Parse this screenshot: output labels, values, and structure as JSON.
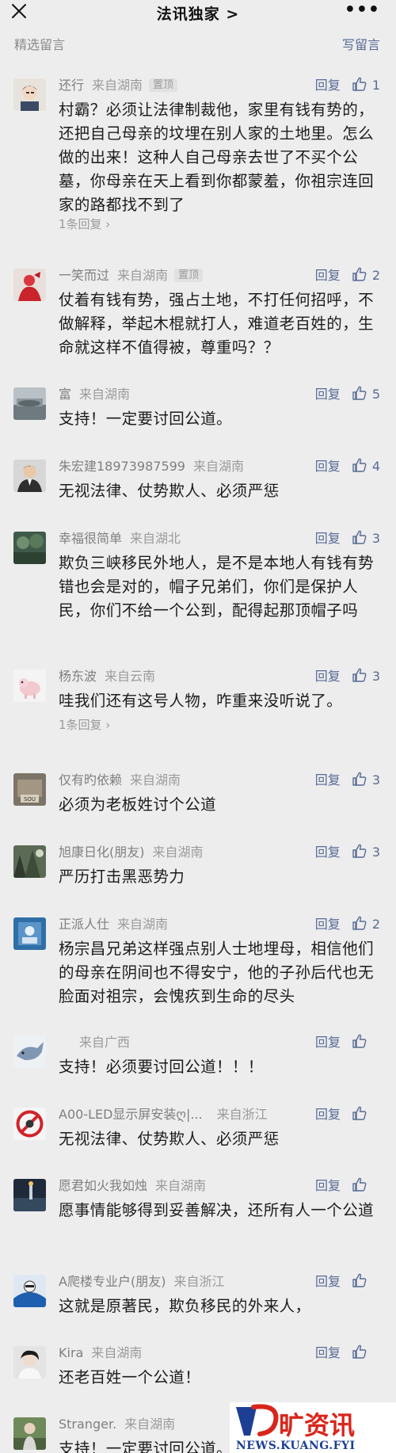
{
  "header": {
    "title": "法讯独家 >",
    "close_icon": "close-icon",
    "more_label": "•••"
  },
  "section": {
    "left_label": "精选留言",
    "right_label": "写留言"
  },
  "comments": [
    {
      "nickname": "还行",
      "location": "来自湖南",
      "pinned": "置顶",
      "reply_label": "回复",
      "likes": "1",
      "text": "村霸？必须让法律制裁他，家里有钱有势的，还把自己母亲的坟埋在别人家的土地里。怎么做的出来！这种人自己母亲去世了不买个公墓，你母亲在天上看到你都蒙羞，你祖宗连回家的路都找不到了",
      "replies_label": "1条回复 ›"
    },
    {
      "nickname": "一笑而过",
      "location": "来自湖南",
      "pinned": "置顶",
      "reply_label": "回复",
      "likes": "2",
      "text": "仗着有钱有势，强占土地，不打任何招呼，不做解释，举起木棍就打人，难道老百姓的，生命就这样不值得被，尊重吗？？"
    },
    {
      "nickname": "富",
      "location": "来自湖南",
      "reply_label": "回复",
      "likes": "5",
      "text": "支持！一定要讨回公道。"
    },
    {
      "nickname": "朱宏建18973987599",
      "location": "来自湖南",
      "reply_label": "回复",
      "likes": "4",
      "text": "无视法律、仗势欺人、必须严惩"
    },
    {
      "nickname": "幸福很简单",
      "location": "来自湖北",
      "reply_label": "回复",
      "likes": "3",
      "text": "欺负三峡移民外地人，是不是本地人有钱有势错也会是对的，帽子兄弟们，你们是保护人民，你们不给一个公到，配得起那顶帽子吗"
    },
    {
      "nickname": "杨东波",
      "location": "来自云南",
      "reply_label": "回复",
      "likes": "3",
      "text": "哇我们还有这号人物，咋重来没听说了。",
      "replies_label": "1条回复 ›"
    },
    {
      "nickname": "仅有旳依赖",
      "location": "来自湖南",
      "reply_label": "回复",
      "likes": "3",
      "text": "必须为老板姓讨个公道"
    },
    {
      "nickname": "旭康日化(朋友)",
      "location": "来自湖南",
      "reply_label": "回复",
      "likes": "3",
      "text": "严历打击黑恶势力"
    },
    {
      "nickname": "正派人仕",
      "location": "来自湖南",
      "reply_label": "回复",
      "likes": "2",
      "text": "杨宗昌兄弟这样强点别人士地埋母，相信他们的母亲在阴间也不得安宁，他的子孙后代也无脸面对祖宗，会愧疚到生命的尽头"
    },
    {
      "nickname": "",
      "location": "来自广西",
      "reply_label": "回复",
      "likes": "",
      "text": "支持！必须要讨回公道！！！"
    },
    {
      "nickname": "A00-LED显示屏安装ღ|...",
      "location": "来自浙江",
      "reply_label": "回复",
      "likes": "",
      "text": "无视法律、仗势欺人、必须严惩"
    },
    {
      "nickname": "愿君如火我如烛",
      "location": "来自湖南",
      "reply_label": "回复",
      "likes": "",
      "text": "愿事情能够得到妥善解决，还所有人一个公道"
    },
    {
      "nickname": "A爬楼专业户(朋友)",
      "location": "来自浙江",
      "reply_label": "回复",
      "likes": "",
      "text": "这就是原著民，欺负移民的外来人，"
    },
    {
      "nickname": "Kira",
      "location": "来自湖南",
      "reply_label": "回复",
      "likes": "",
      "text": "还老百姓一个公道！"
    },
    {
      "nickname": "Stranger.",
      "location": "来自湖南",
      "reply_label": "回复",
      "likes": "",
      "text": "支持！一定要讨回公道。"
    }
  ],
  "watermark": {
    "brand": "旷资讯",
    "site": "NEWS.KUANG.FYI"
  },
  "colors": {
    "background": "#ededed",
    "link": "#576b95",
    "meta": "#8a8a8a",
    "watermark_red": "#d9261c",
    "watermark_blue": "#1c3f94"
  }
}
